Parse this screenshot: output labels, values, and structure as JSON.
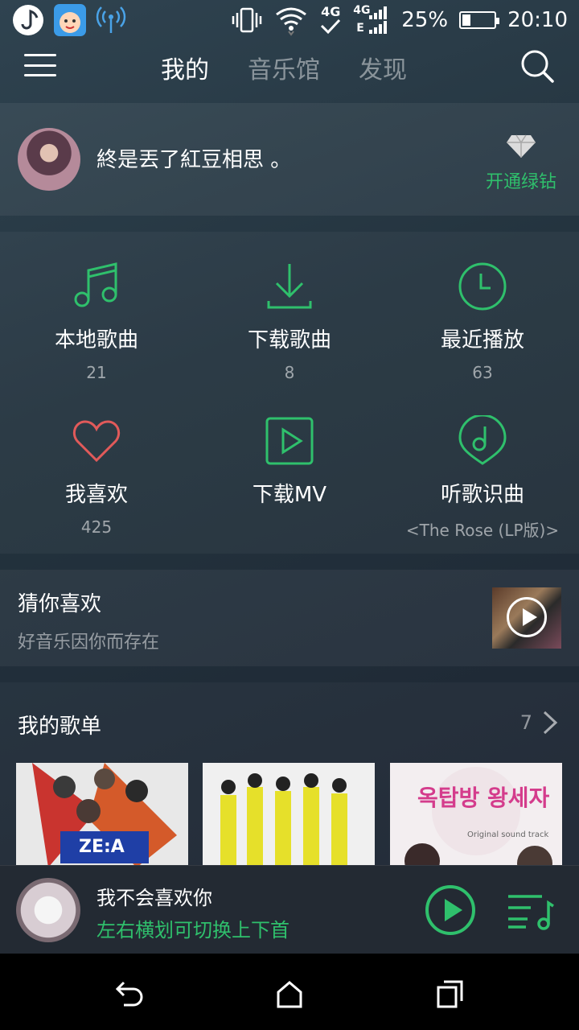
{
  "status_bar": {
    "network_label": "4G",
    "network_label2": "4G",
    "network_label3": "E",
    "battery": "25%",
    "battery_level": 0.25,
    "time": "20:10"
  },
  "topnav": {
    "tabs": [
      {
        "label": "我的",
        "active": true
      },
      {
        "label": "音乐馆",
        "active": false
      },
      {
        "label": "发现",
        "active": false
      }
    ]
  },
  "profile": {
    "username": "終是丟了紅豆相思 。",
    "vip_label": "开通绿钻"
  },
  "grid": {
    "items": [
      {
        "label": "本地歌曲",
        "count": "21",
        "icon": "music-note-icon"
      },
      {
        "label": "下载歌曲",
        "count": "8",
        "icon": "download-icon"
      },
      {
        "label": "最近播放",
        "count": "63",
        "icon": "clock-icon"
      },
      {
        "label": "我喜欢",
        "count": "425",
        "icon": "heart-icon"
      },
      {
        "label": "下载MV",
        "count": "",
        "icon": "play-video-icon"
      },
      {
        "label": "听歌识曲",
        "count": "<The Rose (LP版)>",
        "icon": "recognize-music-icon"
      }
    ]
  },
  "guess": {
    "title": "猜你喜欢",
    "subtitle": "好音乐因你而存在"
  },
  "playlists": {
    "title": "我的歌单",
    "count": "7",
    "albums": [
      {
        "text": "ZE:A",
        "bg": "#e8e8e8"
      },
      {
        "text": "",
        "bg": "#f0f0f0"
      },
      {
        "text": "옥탑방 왕세자",
        "subtext": "Original sound track",
        "bg": "#f3eef0"
      }
    ]
  },
  "player": {
    "song": "我不会喜欢你",
    "hint": "左右横划可切换上下首"
  },
  "colors": {
    "accent": "#2fc06c",
    "heart": "#e15a5a"
  }
}
